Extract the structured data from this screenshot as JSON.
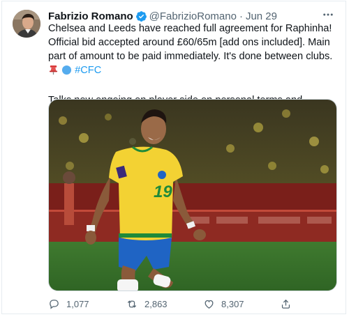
{
  "tweet": {
    "author": {
      "name": "Fabrizio Romano",
      "handle": "@FabrizioRomano",
      "verified": true
    },
    "separator": "·",
    "date": "Jun 29",
    "text_p1": "Chelsea and Leeds have reached full agreement for Raphinha! Official bid accepted around £60/65m [add ons included]. Main part of amount to be paid immediately. It's done between clubs.",
    "hashtag": "#CFC",
    "text_p2": "Talks now ongoing on player side on personal terms and contract. Boehly, on it.",
    "media": {
      "jersey_number": "19"
    },
    "stats": {
      "replies": "1,077",
      "retweets": "2,863",
      "likes": "8,307"
    }
  },
  "colors": {
    "link": "#1d9bf0",
    "secondary_text": "#536471",
    "verified_badge": "#1d9bf0",
    "jersey_yellow": "#f3d233",
    "shorts_blue": "#1f64c4"
  },
  "icons": [
    "verified-badge",
    "more-icon",
    "reply-icon",
    "retweet-icon",
    "like-icon",
    "share-icon",
    "pin-emoji",
    "blue-circle-emoji"
  ]
}
